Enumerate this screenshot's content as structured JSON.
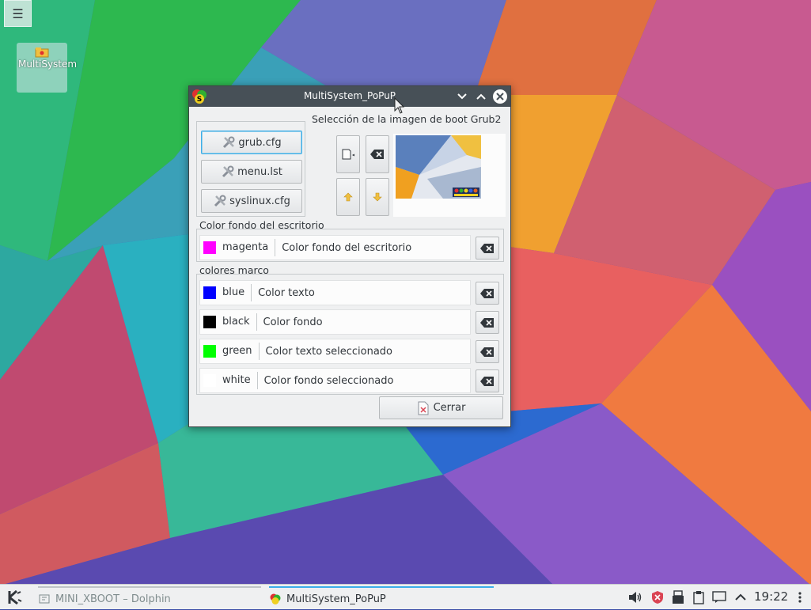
{
  "desktop": {
    "menu_button": "☰",
    "icon_label": "MultiSystem"
  },
  "window": {
    "title": "MultiSystem_PoPuP",
    "buttons": {
      "grub": "grub.cfg",
      "menu": "menu.lst",
      "syslinux": "syslinux.cfg"
    },
    "boot_image_section": "Selección de la imagen de boot Grub2",
    "background_section": "Color fondo del escritorio",
    "background_color": {
      "name": "magenta",
      "desc": "Color fondo del escritorio",
      "hex": "#ff00ff"
    },
    "frame_section": "colores marco",
    "frame_colors": [
      {
        "name": "blue",
        "desc": "Color texto",
        "hex": "#0000ff"
      },
      {
        "name": "black",
        "desc": "Color fondo",
        "hex": "#000000"
      },
      {
        "name": "green",
        "desc": "Color texto seleccionado",
        "hex": "#00ff00"
      },
      {
        "name": "white",
        "desc": "Color fondo seleccionado",
        "hex": "#ffffff"
      }
    ],
    "close_label": "Cerrar"
  },
  "taskbar": {
    "tasks": [
      "MINI_XBOOT – Dolphin",
      "MultiSystem_PoPuP"
    ],
    "clock": "19:22"
  },
  "colors": {
    "accent": "#3daee9",
    "titlebar": "#475057",
    "window_bg": "#eff0f1"
  }
}
